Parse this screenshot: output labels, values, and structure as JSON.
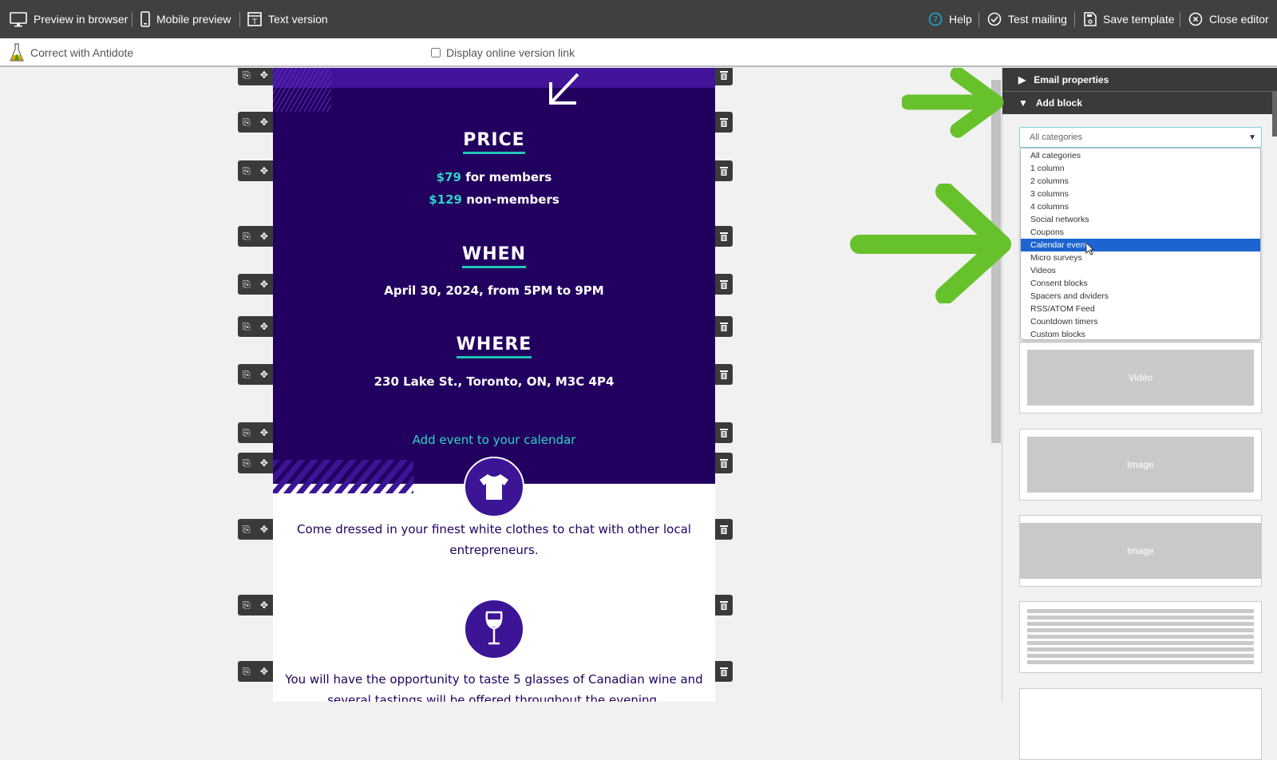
{
  "toolbar": {
    "preview_browser": "Preview in browser",
    "mobile_preview": "Mobile preview",
    "text_version": "Text version",
    "help": "Help",
    "test_mailing": "Test mailing",
    "save_template": "Save template",
    "close_editor": "Close editor"
  },
  "subbar": {
    "antidote": "Correct with Antidote",
    "online_link": "Display online version link",
    "online_link_checked": false
  },
  "email": {
    "price_heading": "PRICE",
    "price_member_amount": "$79",
    "price_member_label": " for members",
    "price_non_amount": "$129",
    "price_non_label": " non-members",
    "when_heading": "WHEN",
    "when_text": "April 30, 2024, from 5PM to 9PM",
    "where_heading": "WHERE",
    "where_text": "230 Lake St., Toronto, ON, M3C 4P4",
    "calendar_link": "Add event to your calendar",
    "dress_text": "Come dressed in your finest white clothes to chat with other local entrepreneurs.",
    "wine_text": "You will have the opportunity to taste 5 glasses of Canadian wine and several tastings will be offered throughout the evening."
  },
  "panel": {
    "email_properties": "Email properties",
    "add_block": "Add block",
    "category_selected": "All categories",
    "category_options": [
      "All categories",
      "1 column",
      "2 columns",
      "3 columns",
      "4 columns",
      "Social networks",
      "Coupons",
      "Calendar event",
      "Micro surveys",
      "Videos",
      "Consent blocks",
      "Spacers and dividers",
      "RSS/ATOM Feed",
      "Countdown timers",
      "Custom blocks"
    ],
    "highlighted_option": "Calendar event",
    "blocks": [
      "Vidéo",
      "Image",
      "Image"
    ]
  },
  "colors": {
    "accent": "#2fd3c3",
    "email_dark": "#22005f",
    "annotation_arrow": "#66c12a",
    "highlight": "#1c64d0"
  }
}
